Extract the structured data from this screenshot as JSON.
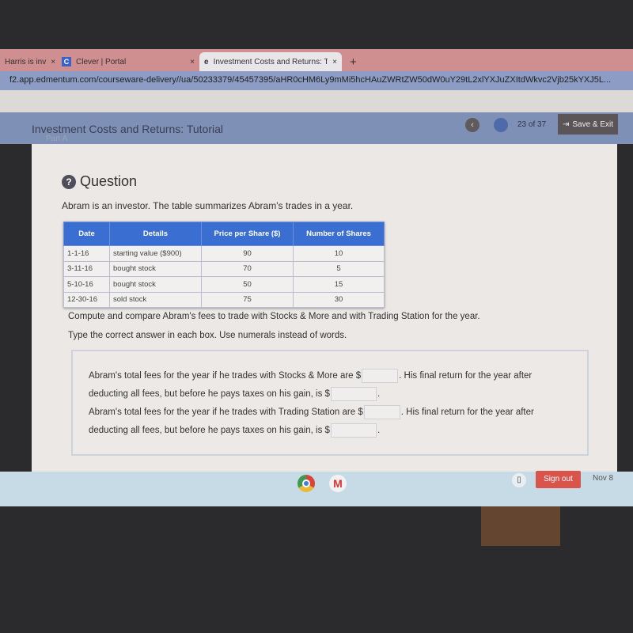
{
  "browser": {
    "tabs": [
      {
        "label": "Harris is inv"
      },
      {
        "label": "Clever | Portal",
        "icon": "C"
      },
      {
        "label": "Investment Costs and Returns: T",
        "icon": "e"
      }
    ],
    "new_tab": "+",
    "close": "×",
    "url": "f2.app.edmentum.com/courseware-delivery//ua/50233379/45457395/aHR0cHM6Ly9mMi5hcHAuZWRtZW50dW0uY29tL2xlYXJuZXItdWkvc2Vjb25kYXJ5L..."
  },
  "header": {
    "title": "Investment Costs and Returns: Tutorial",
    "subtitle": "Part A",
    "prev": "‹",
    "progress": "23  of  37",
    "save_exit": "Save & Exit"
  },
  "question": {
    "icon": "?",
    "label": "Question",
    "intro": "Abram is an investor. The table summarizes Abram's trades in a year.",
    "table": {
      "headers": [
        "Date",
        "Details",
        "Price per Share ($)",
        "Number of Shares"
      ],
      "rows": [
        [
          "1-1-16",
          "starting value ($900)",
          "90",
          "10"
        ],
        [
          "3-11-16",
          "bought stock",
          "70",
          "5"
        ],
        [
          "5-10-16",
          "bought stock",
          "50",
          "15"
        ],
        [
          "12-30-16",
          "sold stock",
          "75",
          "30"
        ]
      ]
    },
    "instruction1": "Compute and compare Abram's fees to trade with Stocks & More and with Trading Station for the year.",
    "instruction2": "Type the correct answer in each box. Use numerals instead of words.",
    "a1": "Abram's total fees for the year if he trades with Stocks & More are $",
    "a1b": ". His final return for the year after",
    "a2": "deducting all fees, but before he pays taxes on his gain, is $",
    "a2b": ".",
    "b1": "Abram's total fees for the year if he trades with Trading Station are $",
    "b1b": ". His final return for the year after",
    "b2": "deducting all fees, but before he pays taxes on his gain, is $",
    "b2b": "."
  },
  "shelf": {
    "gmail": "M",
    "sign_out": "Sign out",
    "date": "Nov 8"
  }
}
